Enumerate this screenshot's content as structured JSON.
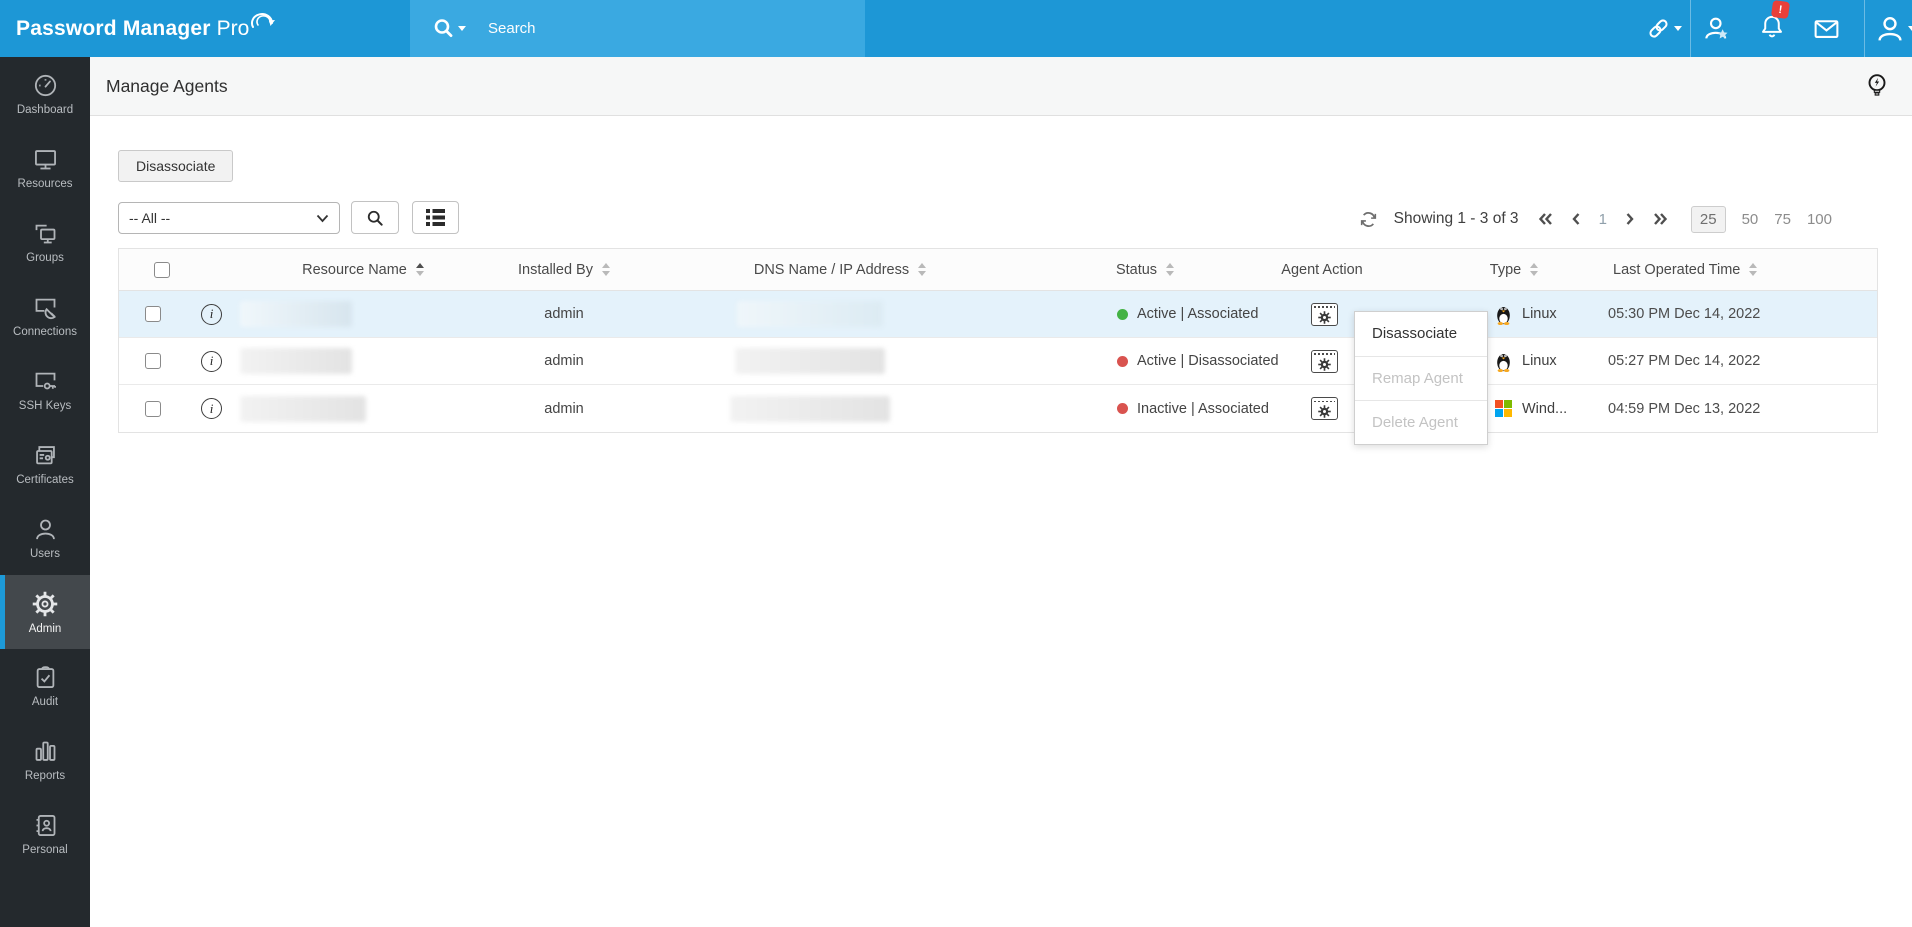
{
  "app": {
    "logo_text": "Password Manager",
    "logo_suffix": "Pro"
  },
  "topbar": {
    "search_placeholder": "Search",
    "notification_badge": "!"
  },
  "sidebar": {
    "items": [
      {
        "label": "Dashboard",
        "icon": "dashboard-icon"
      },
      {
        "label": "Resources",
        "icon": "resources-icon"
      },
      {
        "label": "Groups",
        "icon": "groups-icon"
      },
      {
        "label": "Connections",
        "icon": "connections-icon"
      },
      {
        "label": "SSH Keys",
        "icon": "ssh-keys-icon"
      },
      {
        "label": "Certificates",
        "icon": "certificates-icon"
      },
      {
        "label": "Users",
        "icon": "users-icon"
      },
      {
        "label": "Admin",
        "icon": "admin-gear-icon",
        "active": true
      },
      {
        "label": "Audit",
        "icon": "audit-icon"
      },
      {
        "label": "Reports",
        "icon": "reports-icon"
      },
      {
        "label": "Personal",
        "icon": "personal-icon"
      }
    ]
  },
  "page": {
    "title": "Manage Agents"
  },
  "toolbar": {
    "disassociate_label": "Disassociate",
    "filter_value": "-- All --"
  },
  "pagination": {
    "showing": "Showing 1 - 3 of 3",
    "current_page": "1",
    "page_sizes": [
      "25",
      "50",
      "75",
      "100"
    ],
    "selected_page_size": "25"
  },
  "table": {
    "headers": {
      "resource_name": "Resource Name",
      "installed_by": "Installed By",
      "dns": "DNS Name / IP Address",
      "status": "Status",
      "agent_action": "Agent Action",
      "type": "Type",
      "last_operated_time": "Last Operated Time"
    },
    "rows": [
      {
        "installed_by": "admin",
        "status": "Active | Associated",
        "status_color": "#43b244",
        "type": "Linux",
        "os": "linux",
        "last_operated": "05:30 PM Dec 14, 2022"
      },
      {
        "installed_by": "admin",
        "status": "Active | Disassociated",
        "status_color": "#d9534f",
        "type": "Linux",
        "os": "linux",
        "last_operated": "05:27 PM Dec 14, 2022"
      },
      {
        "installed_by": "admin",
        "status": "Inactive | Associated",
        "status_color": "#d9534f",
        "type": "Wind...",
        "os": "windows",
        "last_operated": "04:59 PM Dec 13, 2022"
      }
    ]
  },
  "context_menu": {
    "items": [
      {
        "label": "Disassociate",
        "enabled": true
      },
      {
        "label": "Remap Agent",
        "enabled": false
      },
      {
        "label": "Delete Agent",
        "enabled": false
      }
    ]
  },
  "colors": {
    "topbar": "#1d97d6",
    "topbar_search": "#3aa9e1",
    "sidebar": "#24292d",
    "sidebar_active": "#43484c",
    "accent": "#1d9ad8",
    "row_highlight": "#e4f2fb",
    "status_green": "#43b244",
    "status_red": "#d9534f",
    "badge_red": "#e8403a"
  }
}
